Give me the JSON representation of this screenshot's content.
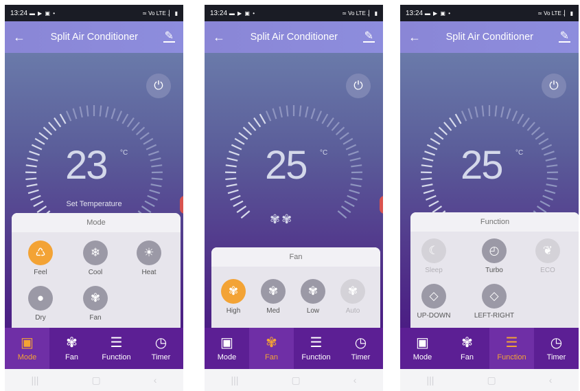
{
  "screens": [
    {
      "status": {
        "time": "13:24",
        "left_icons": "▬ ▶ ▣ •",
        "right_icons": "≃ Vo LTE .▏ ▮"
      },
      "header": {
        "back_icon": "←",
        "title": "Split Air Conditioner",
        "edit_icon": "✎"
      },
      "power_icon": "⏻",
      "temperature": "23",
      "unit": "°C",
      "set_label": "Set Temperature",
      "panel": {
        "title": "Mode",
        "options": [
          {
            "label": "Feel",
            "icon": "♺",
            "state": "selected"
          },
          {
            "label": "Cool",
            "icon": "❄",
            "state": "normal"
          },
          {
            "label": "Heat",
            "icon": "☀",
            "state": "normal"
          },
          {
            "label": "Dry",
            "icon": "●",
            "state": "normal"
          },
          {
            "label": "Fan",
            "icon": "✾",
            "state": "normal"
          }
        ]
      },
      "tabs": [
        {
          "label": "Mode",
          "icon": "▣"
        },
        {
          "label": "Fan",
          "icon": "✾"
        },
        {
          "label": "Function",
          "icon": "☰"
        },
        {
          "label": "Timer",
          "icon": "◷"
        }
      ],
      "active_tab": "Mode",
      "nav": {
        "recent_icon": "|||",
        "home_icon": "▢",
        "back_icon": "‹"
      }
    },
    {
      "status": {
        "time": "13:24",
        "left_icons": "▬ ▶ ▣ •",
        "right_icons": "≃ Vo LTE .▏ ▮"
      },
      "header": {
        "back_icon": "←",
        "title": "Split Air Conditioner",
        "edit_icon": "✎"
      },
      "power_icon": "⏻",
      "temperature": "25",
      "unit": "°C",
      "fan_marks": "✾✾",
      "panel": {
        "title": "Fan",
        "options": [
          {
            "label": "High",
            "icon": "✾",
            "state": "selected"
          },
          {
            "label": "Med",
            "icon": "✾",
            "state": "normal"
          },
          {
            "label": "Low",
            "icon": "✾",
            "state": "normal"
          },
          {
            "label": "Auto",
            "icon": "✾",
            "state": "disabled"
          }
        ]
      },
      "tabs": [
        {
          "label": "Mode",
          "icon": "▣"
        },
        {
          "label": "Fan",
          "icon": "✾"
        },
        {
          "label": "Function",
          "icon": "☰"
        },
        {
          "label": "Timer",
          "icon": "◷"
        }
      ],
      "active_tab": "Fan",
      "nav": {
        "recent_icon": "|||",
        "home_icon": "▢",
        "back_icon": "‹"
      }
    },
    {
      "status": {
        "time": "13:24",
        "left_icons": "▬ ▶ ▣ •",
        "right_icons": "≃ Vo LTE .▏ ▮"
      },
      "header": {
        "back_icon": "←",
        "title": "Split Air Conditioner",
        "edit_icon": "✎"
      },
      "power_icon": "⏻",
      "temperature": "25",
      "unit": "°C",
      "panel": {
        "title": "Function",
        "options": [
          {
            "label": "Sleep",
            "icon": "☾",
            "state": "disabled"
          },
          {
            "label": "Turbo",
            "icon": "◴",
            "state": "normal"
          },
          {
            "label": "ECO",
            "icon": "❦",
            "state": "disabled"
          },
          {
            "label": "UP-DOWN",
            "icon": "◇",
            "state": "normal"
          },
          {
            "label": "LEFT-RIGHT",
            "icon": "◇",
            "state": "normal"
          }
        ]
      },
      "tabs": [
        {
          "label": "Mode",
          "icon": "▣"
        },
        {
          "label": "Fan",
          "icon": "✾"
        },
        {
          "label": "Function",
          "icon": "☰"
        },
        {
          "label": "Timer",
          "icon": "◷"
        }
      ],
      "active_tab": "Function",
      "nav": {
        "recent_icon": "|||",
        "home_icon": "▢",
        "back_icon": "‹"
      }
    }
  ],
  "colors": {
    "accent": "#f3a335",
    "header": "#8a86d6",
    "tabbar": "#5c1f94"
  }
}
